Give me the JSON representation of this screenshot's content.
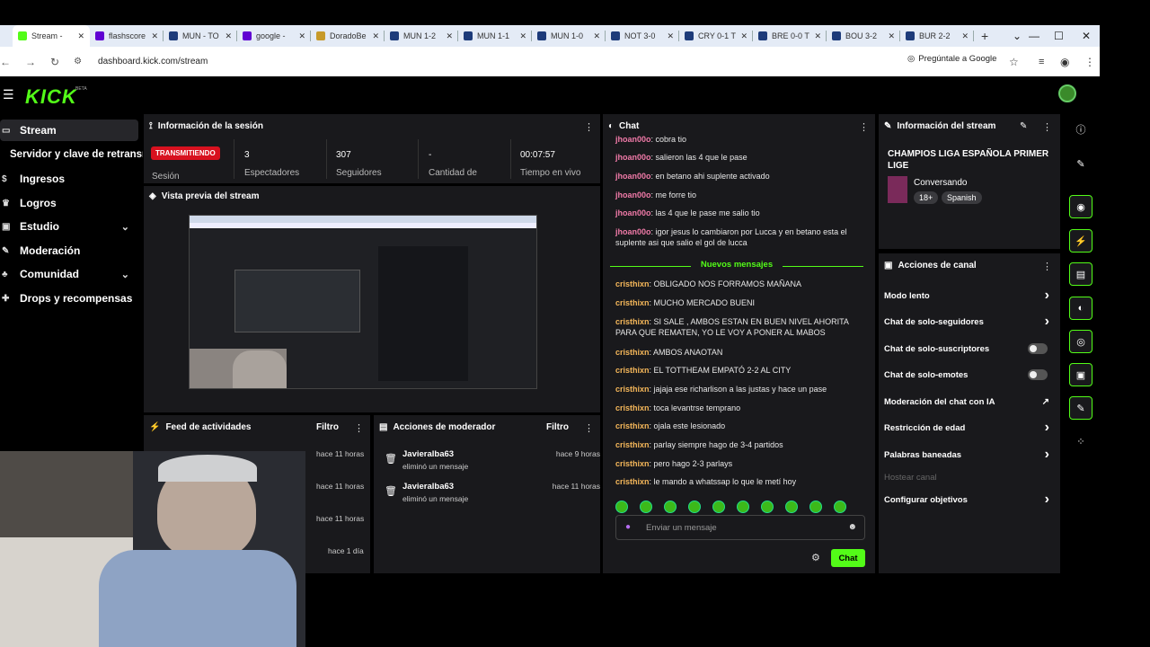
{
  "browser": {
    "tabs": [
      {
        "title": "Stream - ",
        "icon": "kick-icon",
        "color": "#53fc18"
      },
      {
        "title": "flashscore",
        "icon": "yahoo-icon",
        "color": "#6001d2"
      },
      {
        "title": "MUN - TO",
        "icon": "c-icon",
        "color": "#1d3b7a"
      },
      {
        "title": "google - ",
        "icon": "yahoo-icon",
        "color": "#6001d2"
      },
      {
        "title": "DoradoBe",
        "icon": "dorado-icon",
        "color": "#c79a2a"
      },
      {
        "title": "MUN 1-2",
        "icon": "c-icon",
        "color": "#1d3b7a"
      },
      {
        "title": "MUN 1-1",
        "icon": "c-icon",
        "color": "#1d3b7a"
      },
      {
        "title": "MUN 1-0",
        "icon": "c-icon",
        "color": "#1d3b7a"
      },
      {
        "title": "NOT 3-0",
        "icon": "c-icon",
        "color": "#1d3b7a"
      },
      {
        "title": "CRY 0-1 T",
        "icon": "c-icon",
        "color": "#1d3b7a"
      },
      {
        "title": "BRE 0-0 T",
        "icon": "c-icon",
        "color": "#1d3b7a"
      },
      {
        "title": "BOU 3-2",
        "icon": "c-icon",
        "color": "#1d3b7a"
      },
      {
        "title": "BUR 2-2",
        "icon": "c-icon",
        "color": "#1d3b7a"
      }
    ],
    "url": "dashboard.kick.com/stream",
    "ask_google": "Pregúntale a Google"
  },
  "brand": {
    "logo": "KICK",
    "beta": "BETA",
    "accent": "#53fc18"
  },
  "sidebar": {
    "items": [
      {
        "label": "Stream",
        "icon": "stream-icon"
      },
      {
        "label": "Servidor y clave de retransmisión"
      },
      {
        "label": "Ingresos",
        "icon": "money-icon"
      },
      {
        "label": "Logros",
        "icon": "trophy-icon"
      },
      {
        "label": "Estudio",
        "icon": "studio-icon"
      },
      {
        "label": "Moderación",
        "icon": "wrench-icon"
      },
      {
        "label": "Comunidad",
        "icon": "community-icon"
      },
      {
        "label": "Drops y recompensas",
        "icon": "gift-icon"
      }
    ]
  },
  "session": {
    "title": "Información de la sesión",
    "live_badge": "TRANSMITIENDO",
    "stats": [
      {
        "label": "Sesión",
        "value": ""
      },
      {
        "label": "Espectadores",
        "value": "3"
      },
      {
        "label": "Seguidores",
        "value": "307"
      },
      {
        "label": "Cantidad de",
        "value": "-"
      },
      {
        "label": "Tiempo en vivo",
        "value": "00:07:57"
      }
    ]
  },
  "preview": {
    "title": "Vista previa del stream"
  },
  "feed": {
    "title": "Feed de actividades",
    "filter": "Filtro",
    "times": [
      "hace 11 horas",
      "hace 11 horas",
      "hace 11 horas",
      "hace 1 día"
    ]
  },
  "mod_actions": {
    "title": "Acciones de moderador",
    "filter": "Filtro",
    "items": [
      {
        "user": "Javieralba63",
        "action": "eliminó un mensaje",
        "time": "hace 9 horas"
      },
      {
        "user": "Javieralba63",
        "action": "eliminó un mensaje",
        "time": "hace 11 horas"
      }
    ]
  },
  "chat": {
    "title": "Chat",
    "messages_before": [
      {
        "user": "jhoan00o",
        "text": "cobra tio"
      },
      {
        "user": "jhoan00o",
        "text": "salieron las 4 que le pase"
      },
      {
        "user": "jhoan00o",
        "text": "en betano ahi suplente activado"
      },
      {
        "user": "jhoan00o",
        "text": "me forre tio"
      },
      {
        "user": "jhoan00o",
        "text": "las 4 que le pase me salio tio"
      },
      {
        "user": "jhoan00o",
        "text": "igor jesus lo cambiaron por Lucca y en betano esta el suplente asi que salio el gol de lucca"
      }
    ],
    "new_messages_label": "Nuevos mensajes",
    "messages_after": [
      {
        "user": "cristhixn",
        "text": "OBLIGADO NOS FORRAMOS MAÑANA"
      },
      {
        "user": "cristhixn",
        "text": "MUCHO MERCADO BUENI"
      },
      {
        "user": "cristhixn",
        "text": "SI SALE , AMBOS ESTAN EN BUEN NIVEL AHORITA PARA QUE REMATEN, YO LE VOY A PONER AL MABOS"
      },
      {
        "user": "cristhixn",
        "text": "AMBOS ANAOTAN"
      },
      {
        "user": "cristhixn",
        "text": "EL TOTTHEAM EMPATÓ 2-2 AL CITY"
      },
      {
        "user": "cristhixn",
        "text": "jajaja ese richarlison a las justas y hace un pase"
      },
      {
        "user": "cristhixn",
        "text": "toca levantrse temprano"
      },
      {
        "user": "cristhixn",
        "text": "ojala este lesionado"
      },
      {
        "user": "cristhixn",
        "text": "parlay siempre hago de 3-4 partidos"
      },
      {
        "user": "cristhixn",
        "text": "pero hago 2-3 parlays"
      },
      {
        "user": "cristhixn",
        "text": "le mando a whatssap lo que le metí hoy"
      }
    ],
    "user_colors": {
      "jhoan00o": "#f07aa8",
      "cristhixn": "#f5b75a"
    },
    "input_placeholder": "Enviar un mensaje",
    "send_label": "Chat"
  },
  "stream_info": {
    "title": "Información del stream",
    "stream_title": "CHAMPIOS LIGA ESPAÑOLA PRIMER LIGE",
    "category": "Conversando",
    "age_badge": "18+",
    "language": "Spanish"
  },
  "channel_actions": {
    "title": "Acciones de canal",
    "items": [
      {
        "label": "Modo lento",
        "control": "arrow"
      },
      {
        "label": "Chat de solo-seguidores",
        "control": "arrow"
      },
      {
        "label": "Chat de solo-suscriptores",
        "control": "toggle"
      },
      {
        "label": "Chat de solo-emotes",
        "control": "toggle"
      },
      {
        "label": "Moderación del chat con IA",
        "control": "external"
      },
      {
        "label": "Restricción de edad",
        "control": "arrow"
      },
      {
        "label": "Palabras baneadas",
        "control": "arrow"
      },
      {
        "label": "Hostear canal",
        "control": "none"
      },
      {
        "label": "Configurar objetivos",
        "control": "arrow"
      }
    ]
  }
}
